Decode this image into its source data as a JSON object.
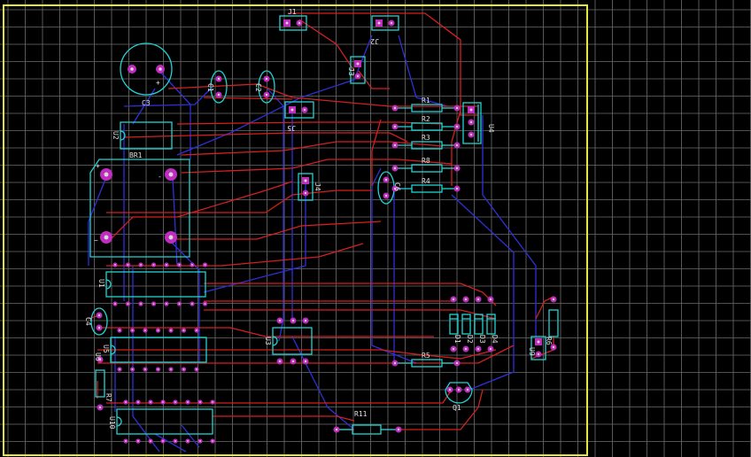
{
  "colors": {
    "background": "#000000",
    "grid": "#7a7a7a",
    "board_outline": "#e8e83a",
    "silkscreen": "#22d3d3",
    "pad": "#c02bc0",
    "pad_hole": "#d8d8d8",
    "trace_top": "#d42020",
    "trace_bottom": "#3030d8"
  },
  "labels": {
    "j1": "J1",
    "j2": "J2",
    "j3": "J3",
    "j4": "J4",
    "j5": "J5",
    "u4": "U4",
    "c3": "C3",
    "c1": "C1",
    "c2": "C2",
    "br1": "BR1",
    "u2": "U2",
    "u3": "U3",
    "u1": "U1",
    "u5": "U5",
    "u10": "U10",
    "u6": "U6",
    "c4": "C4",
    "c6": "C6",
    "r1": "R1",
    "r2": "R2",
    "r3": "R3",
    "r4": "R4",
    "r5": "R5",
    "r6": "R6",
    "r7": "R7",
    "r8": "R8",
    "r11": "R11",
    "d1": "D1",
    "d2": "D2",
    "d3": "D3",
    "d4": "D4",
    "q1": "Q1",
    "u9": "U9",
    "br_plus": "+",
    "br_minus": "-",
    "br_ac1": "~",
    "br_ac2": "~",
    "c3_plus": "+"
  }
}
